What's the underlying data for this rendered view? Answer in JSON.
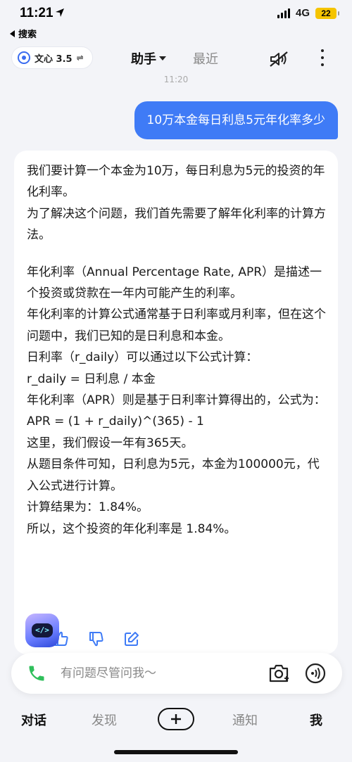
{
  "status_bar": {
    "time": "11:21",
    "network": "4G",
    "battery": "22"
  },
  "back_label": "搜索",
  "header": {
    "model_label": "文心 3.5",
    "model_switch_glyph": "⇌",
    "tab_assistant": "助手",
    "tab_recent": "最近"
  },
  "timestamp": "11:20",
  "user_message": "10万本金每日利息5元年化率多少",
  "bot_reply": {
    "paragraphs": [
      "我们要计算一个本金为10万，每日利息为5元的投资的年化利率。",
      "为了解决这个问题，我们首先需要了解年化利率的计算方法。",
      "年化利率（Annual Percentage Rate, APR）是描述一个投资或贷款在一年内可能产生的利率。",
      "年化利率的计算公式通常基于日利率或月利率，但在这个问题中，我们已知的是日利息和本金。",
      "日利率（r_daily）可以通过以下公式计算：",
      "r_daily = 日利息 / 本金",
      "年化利率（APR）则是基于日利率计算得出的，公式为：",
      "APR = (1 + r_daily)^(365) - 1",
      "这里，我们假设一年有365天。",
      "从题目条件可知，日利息为5元，本金为100000元，代入公式进行计算。",
      "计算结果为：1.84%。",
      "所以，这个投资的年化利率是 1.84%。"
    ]
  },
  "input": {
    "placeholder": "有问题尽管问我～"
  },
  "bottom_nav": {
    "chat": "对话",
    "discover": "发现",
    "notify": "通知",
    "me": "我"
  },
  "colors": {
    "accent": "#3f7bf6",
    "phone": "#2fbf5b"
  }
}
